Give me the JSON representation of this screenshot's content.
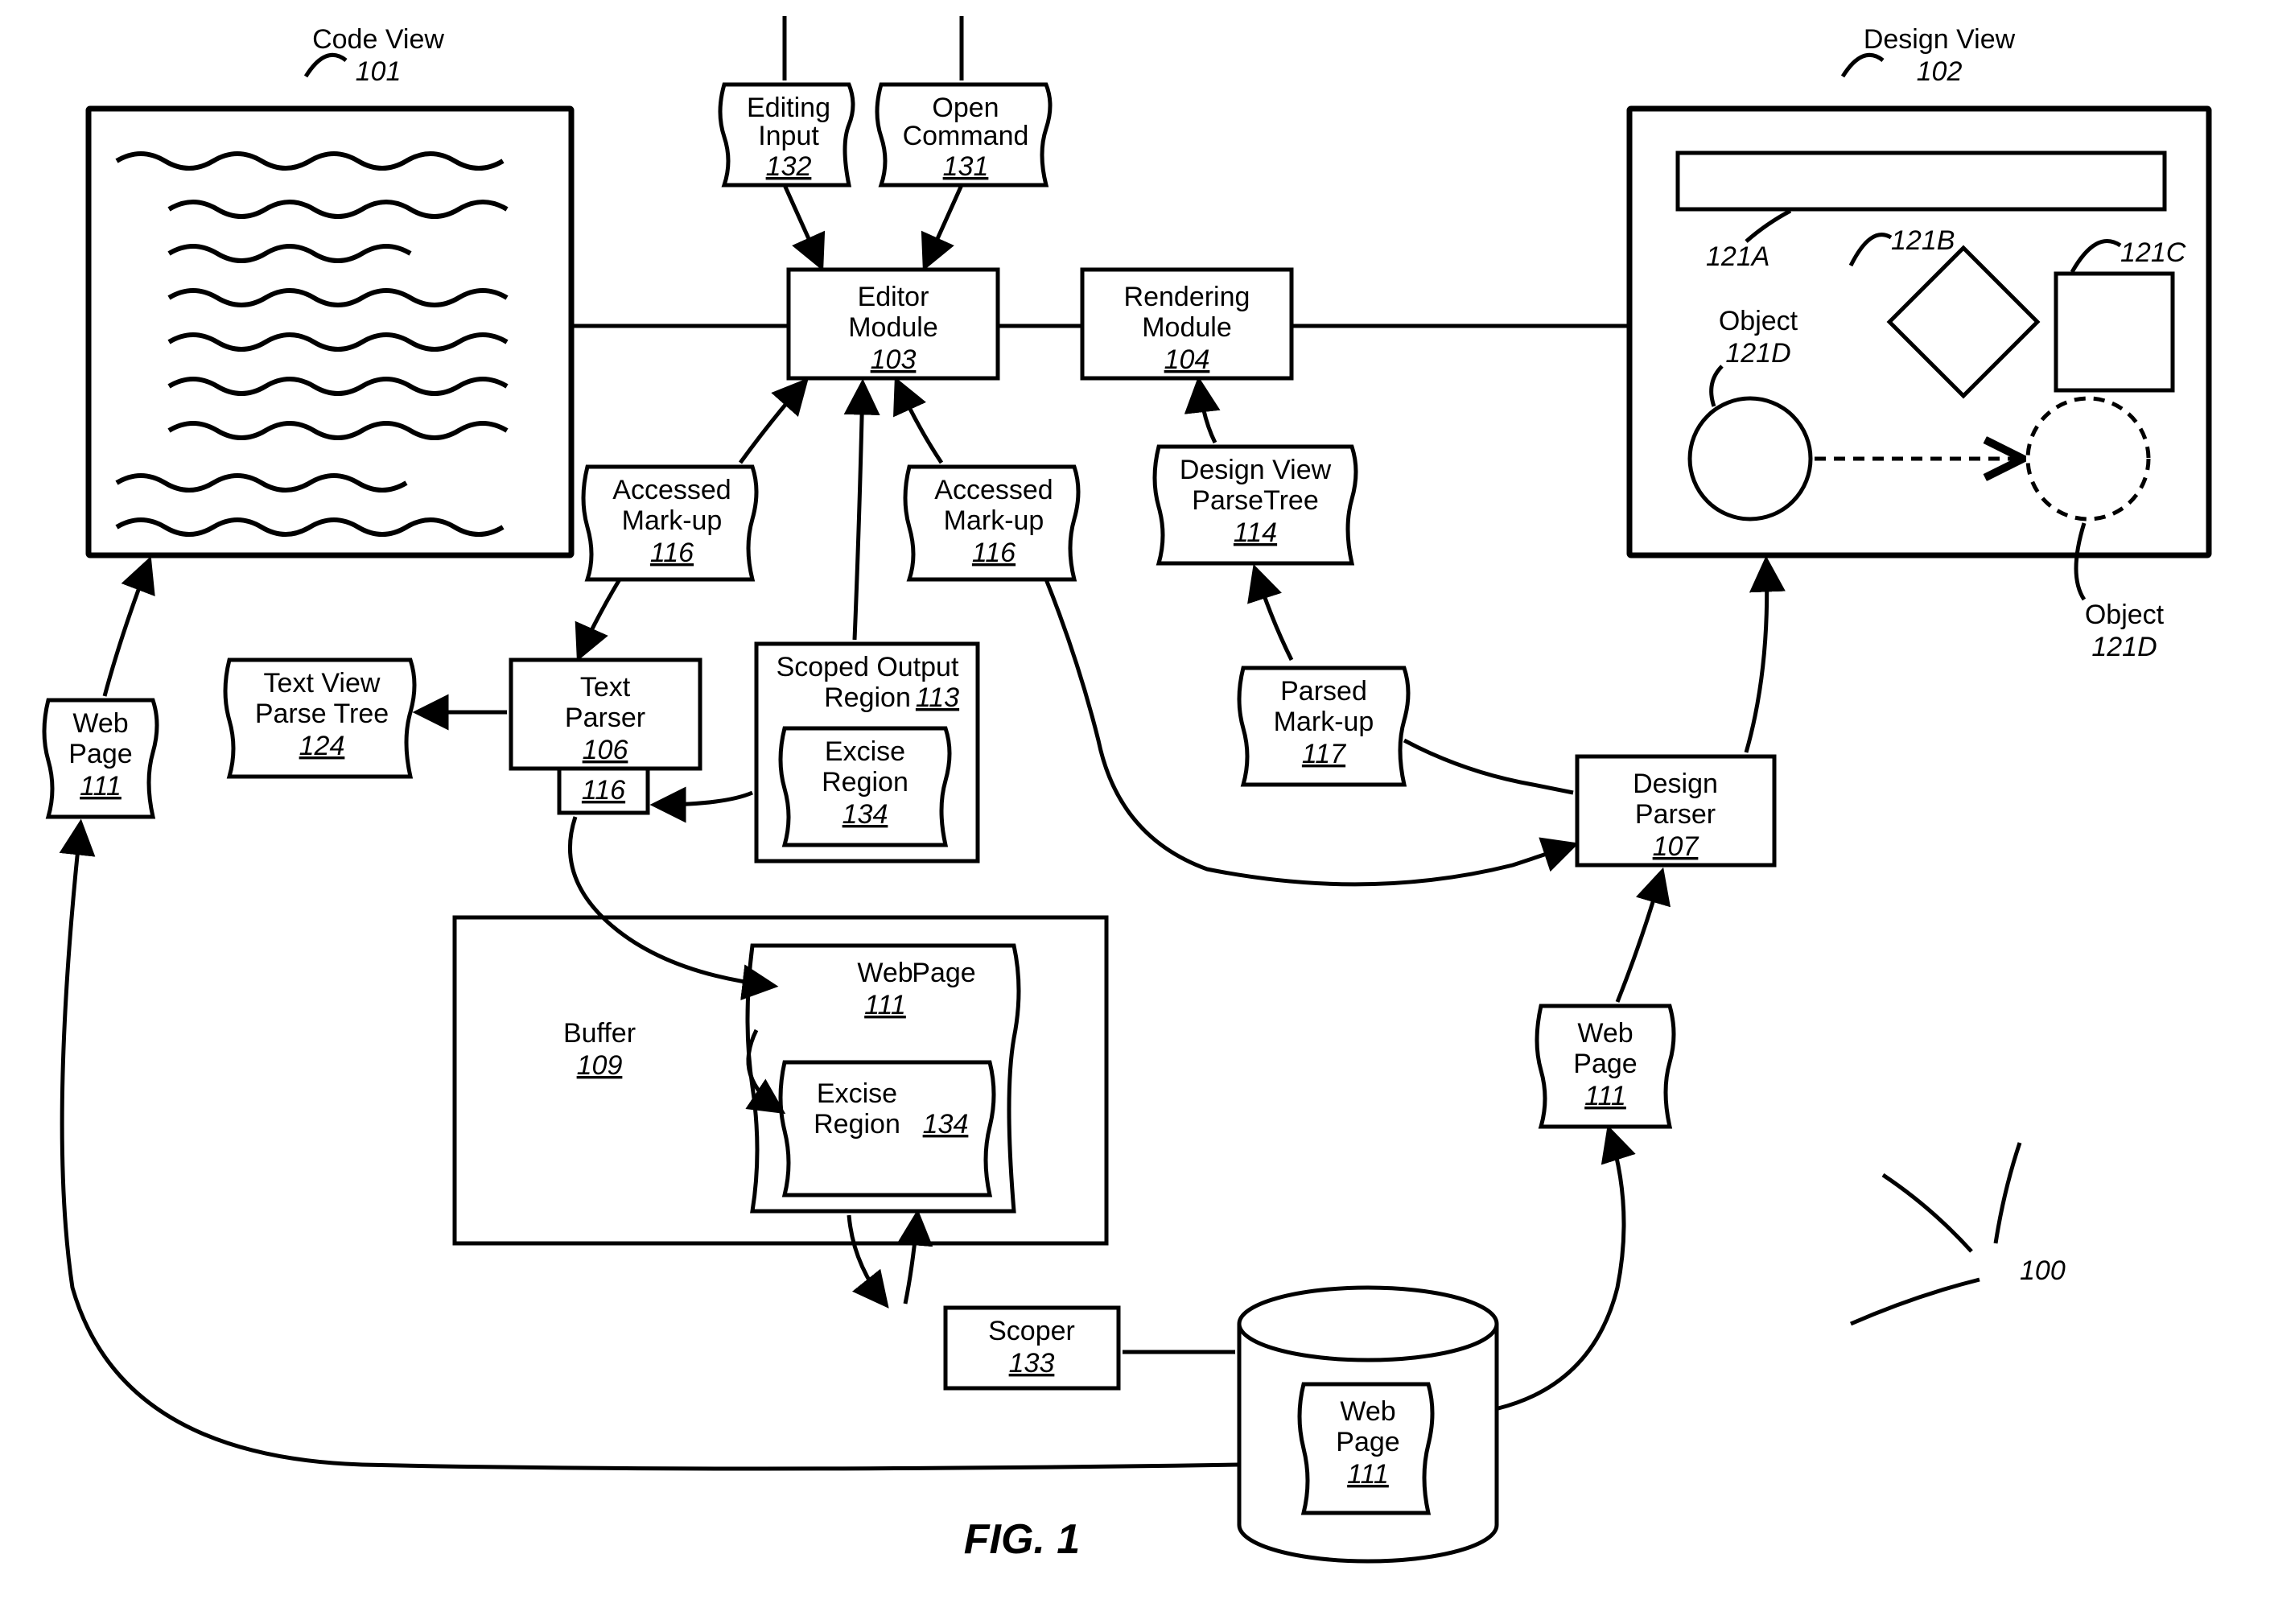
{
  "figure_label": "FIG. 1",
  "system_ref": "100",
  "code_view": {
    "title": "Code View",
    "ref": "101"
  },
  "design_view": {
    "title": "Design View",
    "ref": "102",
    "obj121A": "121A",
    "obj121B": "121B",
    "obj121C": "121C",
    "obj121D_label": "Object",
    "obj121D_ref": "121D",
    "obj121D_dashed_label": "Object",
    "obj121D_dashed_ref": "121D"
  },
  "editor_module": {
    "label": "Editor\nModule",
    "ref": "103"
  },
  "rendering_module": {
    "label": "Rendering\nModule",
    "ref": "104"
  },
  "text_parser": {
    "label": "Text\nParser",
    "ref": "106"
  },
  "design_parser": {
    "label": "Design\nParser",
    "ref": "107"
  },
  "buffer": {
    "label": "Buffer",
    "ref": "109"
  },
  "scoper": {
    "label": "Scoper",
    "ref": "133"
  },
  "text_view_pt": {
    "label1": "Text View",
    "label2": "Parse Tree",
    "ref": "124"
  },
  "design_view_pt": {
    "label1": "Design View",
    "label2": "ParseTree",
    "ref": "114"
  },
  "editing_input": {
    "label1": "Editing",
    "label2": "Input",
    "ref": "132"
  },
  "open_command": {
    "label1": "Open",
    "label2": "Command",
    "ref": "131"
  },
  "accessed_markup1": {
    "label1": "Accessed",
    "label2": "Mark-up",
    "ref": "116"
  },
  "accessed_markup2": {
    "label1": "Accessed",
    "label2": "Mark-up",
    "ref": "116"
  },
  "parsed_markup": {
    "label1": "Parsed",
    "label2": "Mark-up",
    "ref": "117"
  },
  "scoped_output": {
    "label1": "Scoped Output",
    "label2": "Region",
    "ref": "113"
  },
  "excise_region1": {
    "label1": "Excise",
    "label2": "Region",
    "ref": "134"
  },
  "excise_region2": {
    "label1": "Excise",
    "label2": "Region",
    "ref": "134"
  },
  "webpage": {
    "label1": "Web",
    "label2": "Page",
    "ref": "111"
  },
  "small116": "116"
}
